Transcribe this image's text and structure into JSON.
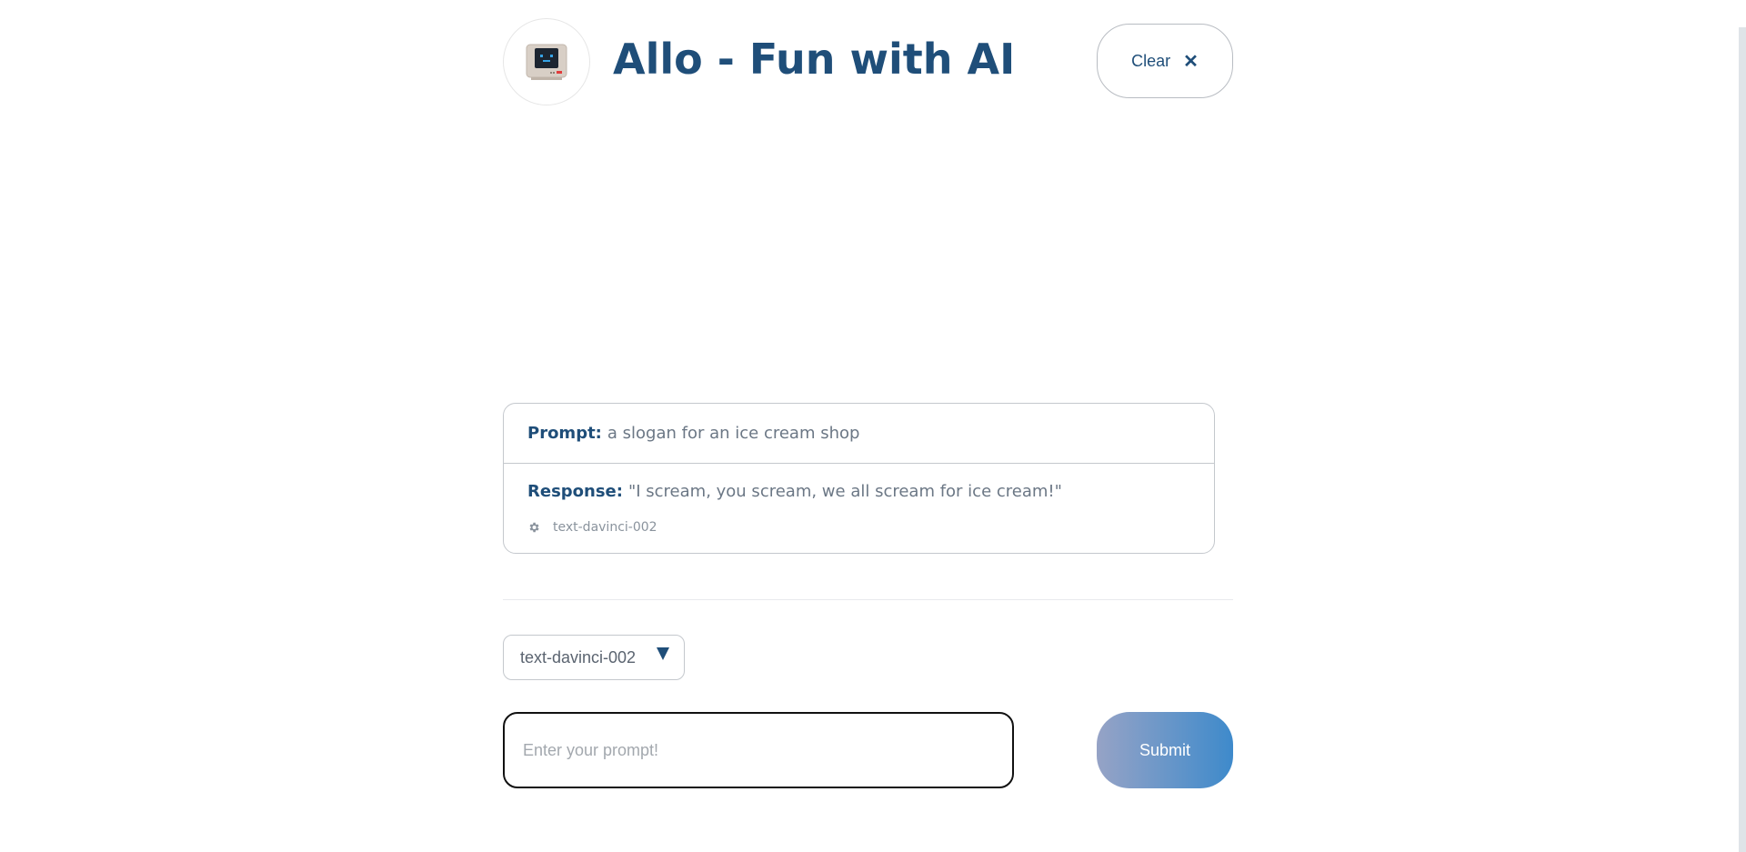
{
  "app": {
    "title": "Allo - Fun with AI",
    "logo_icon": "robot-computer-icon"
  },
  "toolbar": {
    "clear_label": "Clear",
    "clear_icon_glyph": "✕"
  },
  "history": [
    {
      "prompt_label": "Prompt:",
      "prompt_text": "a slogan for an ice cream shop",
      "response_label": "Response:",
      "response_text": "\"I scream, you scream, we all scream for ice cream!\"",
      "model": "text-davinci-002"
    }
  ],
  "form": {
    "selected_model": "text-davinci-002",
    "prompt_placeholder": "Enter your prompt!",
    "prompt_value": "",
    "submit_label": "Submit"
  },
  "colors": {
    "brand_text": "#1f4e79",
    "muted_text": "#6b7785",
    "border": "#c4c8cd",
    "submit_gradient_start": "#96a3c6",
    "submit_gradient_end": "#3e8acb"
  }
}
